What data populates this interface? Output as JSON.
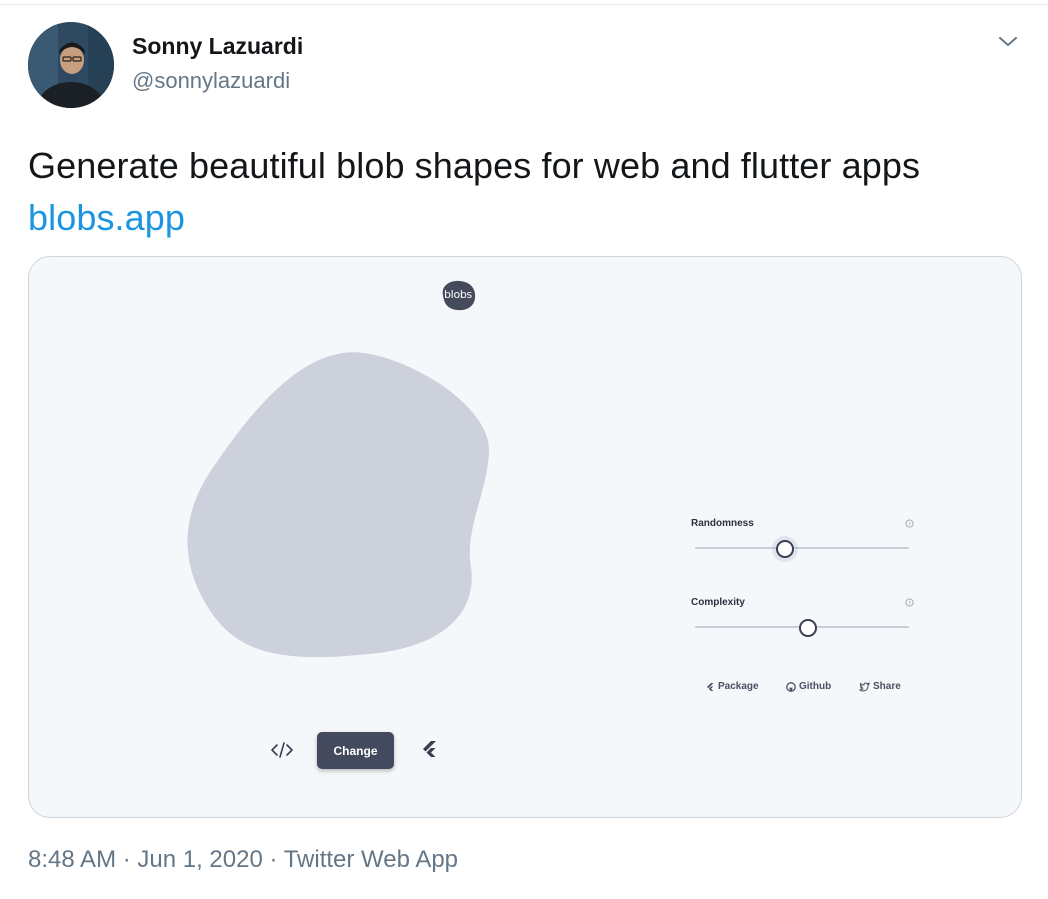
{
  "tweet": {
    "author_name": "Sonny Lazuardi",
    "author_handle": "@sonnylazuardi",
    "text": "Generate beautiful blob shapes for web and flutter apps",
    "link_text": "blobs.app",
    "timestamp": "8:48 AM · Jun 1, 2020 · Twitter Web App"
  },
  "card": {
    "logo_text": "blobs",
    "change_button": "Change",
    "controls": [
      {
        "label": "Randomness",
        "value_fraction": 0.42
      },
      {
        "label": "Complexity",
        "value_fraction": 0.53
      }
    ],
    "links": {
      "package": "Package",
      "github": "Github",
      "share": "Share"
    }
  },
  "colors": {
    "link": "#1b95e0",
    "blob": "#cdd1db",
    "card_bg": "#f5f7fa",
    "button": "#444a5e"
  },
  "icons": [
    "chevron-down-icon",
    "code-icon",
    "flutter-icon",
    "help-icon",
    "github-icon",
    "twitter-icon"
  ]
}
